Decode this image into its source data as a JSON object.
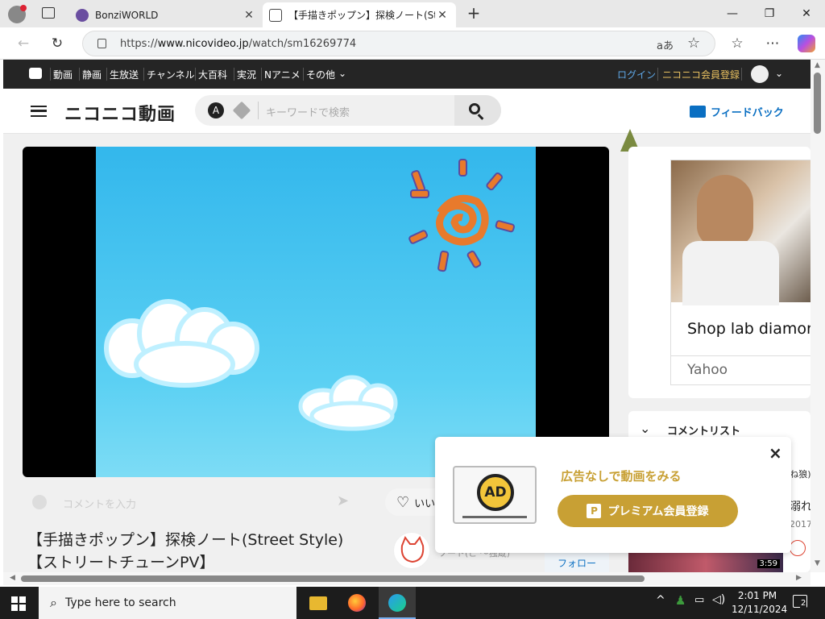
{
  "browser": {
    "tabs": [
      {
        "title": "BonziWORLD",
        "active": false
      },
      {
        "title": "【手描きポップン】探検ノート(Street St",
        "active": true
      }
    ],
    "new_tab_label": "+",
    "url_prefix": "https://",
    "url_domain": "www.nicovideo.jp",
    "url_path": "/watch/sm16269774"
  },
  "nico": {
    "nav": [
      "動画",
      "静画",
      "生放送",
      "チャンネル",
      "大百科",
      "実況",
      "Nアニメ",
      "その他"
    ],
    "login": "ログイン",
    "register": "ニコニコ会員登録",
    "logo": "ニコニコ動画",
    "search_placeholder": "キーワードで検索",
    "feedback": "フィードバック",
    "comment_placeholder": "コメントを入力",
    "like_label": "いい",
    "video_title_line1": "【手描きポップン】探検ノート(Street Style)",
    "video_title_line2": "【ストリートチューンPV】",
    "follow": "フォロー",
    "uploader_partial": "ソート(ピ ～独蔵)"
  },
  "ad": {
    "headline": "Shop lab diamor",
    "source": "Yahoo"
  },
  "comments": {
    "header": "コメントリスト",
    "side_snippets": [
      "(ね狼)",
      "溺れ",
      "2017"
    ],
    "thumb_time": "3:59"
  },
  "premium_popup": {
    "icon_text": "AD",
    "message": "広告なしで動画をみる",
    "button": "プレミアム会員登録",
    "button_badge": "P",
    "close": "×"
  },
  "taskbar": {
    "search_placeholder": "Type here to search",
    "time": "2:01 PM",
    "date": "12/11/2024",
    "notifications": "2"
  },
  "colors": {
    "nico_bar": "#252525",
    "accent_blue": "#0a6fc2",
    "gold": "#c8a034",
    "sky": "#33b7ec"
  }
}
